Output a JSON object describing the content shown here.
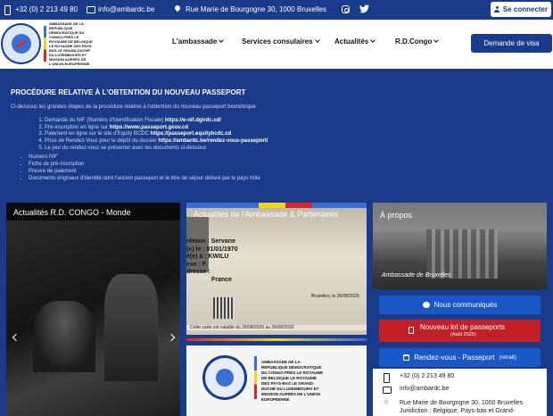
{
  "topbar": {
    "phone": "+32 (0) 2 213 49 80",
    "email": "info@ambardc.be",
    "address": "Rue Marie de Bourgogne 30, 1000 Bruxelles",
    "login_label": "Se connecter"
  },
  "header": {
    "logo_text": "AMBASSADE DE LA RÉPUBLIQUE DÉMOCRATIQUE DU CONGO PRÈS LE ROYAUME DE BELGIQUE LE ROYAUME DES PAYS-BAS LE GRAND-DUCHÉ DU LUXEMBOURG ET MISSION AUPRÈS DE L'UNION EUROPÉENNE",
    "nav": [
      {
        "label": "L'ambassade"
      },
      {
        "label": "Services consulaires"
      },
      {
        "label": "Actualités"
      },
      {
        "label": "R.D.Congo"
      }
    ],
    "visa_label": "Demande de visa"
  },
  "procedure": {
    "title": "Procédure relative à l'obtention du nouveau passeport",
    "intro": "Ci-dessous les grandes étapes de la procédure relative à l'obtention du nouveau passeport biométrique",
    "steps": [
      {
        "text": "Demande du NIF (Numéro d'Identification Fiscale) ",
        "link": "https://e-nif.dgirdc.cd/"
      },
      {
        "text": "Pré-inscription en ligne sur ",
        "link": "https://www.passeport.gouv.cd"
      },
      {
        "text": "Paiement en ligne sur le site d'Equity BCDC ",
        "link": "https://passeport.equitybcdc.cd"
      },
      {
        "text": "Prise de Rendez-Vous pour le dépôt du dossier ",
        "link": "https://ambardc.be/rendez-vous-passeport/"
      },
      {
        "text": "Le jour du rendez-vous se présenter avec les documents ci-dessous",
        "link": ""
      }
    ],
    "documents": [
      "Numéro NIF",
      "Fiche de pré-inscription",
      "Preuve de paiement",
      "Documents originaux d'identité dont l'ancien passeport et le titre de séjour délivré par le pays hôte"
    ]
  },
  "cards": {
    "news_title": "Actualités R.D. CONGO - Monde",
    "embassy_title": "Actualités de l'Ambassade & Partenaires",
    "embassy_doc": {
      "lines": [
        "rénom : Servane",
        "(e) le : 01/01/1970",
        "é(e) à : KWILU",
        "exe : F",
        "dresse :"
      ],
      "country": "France",
      "date": "Bruxelles, le 26/08/2025",
      "validity": "Cette carte est valable du 26/08/2025 au 26/08/2030"
    },
    "embassy_logo_text": "AMBASSADE DE LA RÉPUBLIQUE DÉMOCRATIQUE DU CONGO PRÈS LE ROYAUME DE BELGIQUE LE ROYAUME DES PAYS-BAS LE GRAND-DUCHÉ DU LUXEMBOURG ET MISSION AUPRÈS DE L'UNION EUROPÉENNE",
    "about_title": "À propos",
    "about_caption": "Ambassade de Bruxelles"
  },
  "sidebar": {
    "communiques_label": "Nous communiqués",
    "lot_label": "Nouveau lot de passeports",
    "lot_sub": "(Août 2025)",
    "rdv_label": "Rendez-vous - Passeport",
    "rdv_sub": "(retrait)",
    "contact": {
      "phone": "+32 (0) 2 213 49 80",
      "email": "info@ambardc.be",
      "address": "Rue Marie de Bourgogne 30, 1000 Bruxelles",
      "jurisdiction": "Juridiction : Belgique, Pays-bas et Grand-"
    }
  },
  "colors": {
    "primary": "#1a3a8a",
    "button_blue": "#1a57c7",
    "button_red": "#c12027"
  }
}
